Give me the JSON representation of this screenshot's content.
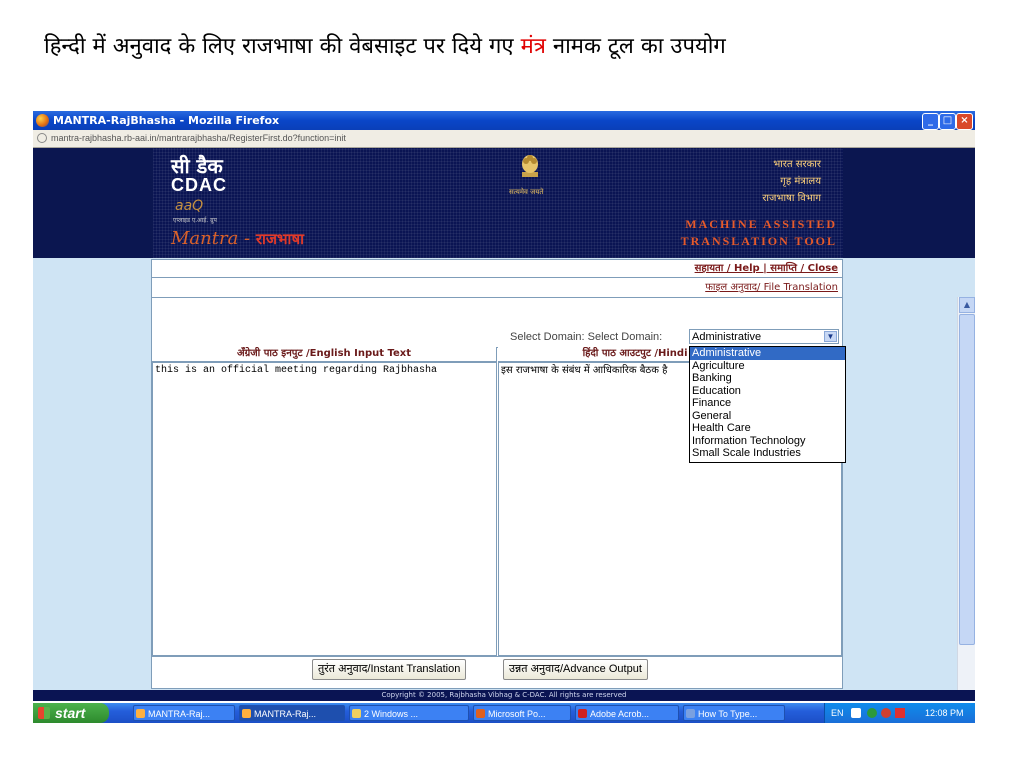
{
  "slide": {
    "title_part1": "हिन्दी में अनुवाद के लिए राजभाषा की वेबसाइट पर दिये गए ",
    "title_highlight": "मंत्र",
    "title_part2": " नामक टूल का उपयोग"
  },
  "window": {
    "title": "MANTRA-RajBhasha - Mozilla Firefox",
    "url": "mantra-rajbhasha.rb-aai.in/mantrarajbhasha/RegisterFirst.do?function=init",
    "min": "_",
    "max": "□",
    "close": "×"
  },
  "banner": {
    "cdac_hindi": "सी डैक",
    "cdac_en": "CDAC",
    "cdac_small": "aaQ",
    "cdac_tiny": "एप्लाइड ए.आई. ग्रुप",
    "emblem_text": "सत्यमेव जयते",
    "gov_line1": "भारत सरकार",
    "gov_line2": "गृह मंत्रालय",
    "gov_line3": "राजभाषा विभाग",
    "mantra_logo": "Mantra - ",
    "mantra_hindi": "राजभाषा",
    "mat_line1": "MACHINE ASSISTED",
    "mat_line2": "TRANSLATION TOOL"
  },
  "nav": {
    "links": "सहायता / Help | समाप्ति / Close",
    "file_translation": "फाइल अनुवाद/ File Translation"
  },
  "domain": {
    "label": "Select Domain: Select Domain:",
    "selected": "Administrative",
    "options": [
      "Administrative",
      "Agriculture",
      "Banking",
      "Education",
      "Finance",
      "General",
      "Health Care",
      "Information Technology",
      "Small Scale Industries"
    ]
  },
  "columns": {
    "input_header": "अँग्रेजी पाठ इनपुट /English Input Text",
    "output_header": "हिंदी पाठ आउटपुट /Hindi Output Text",
    "input_text": "this is an official meeting regarding Rajbhasha",
    "output_text": "इस राजभाषा के संबंध में आधिकारिक बैठक है"
  },
  "buttons": {
    "instant": "तुरंत अनुवाद/Instant Translation",
    "advance": "उन्नत अनुवाद/Advance Output"
  },
  "footer": "Copyright © 2005, Rajbhasha Vibhag & C-DAC. All rights are reserved",
  "taskbar": {
    "start": "start",
    "tasks": [
      "MANTRA-Raj...",
      "MANTRA-Raj...",
      "2 Windows ...",
      "Microsoft Po...",
      "Adobe Acrob...",
      "How To Type..."
    ],
    "lang": "EN",
    "clock": "12:08 PM"
  }
}
